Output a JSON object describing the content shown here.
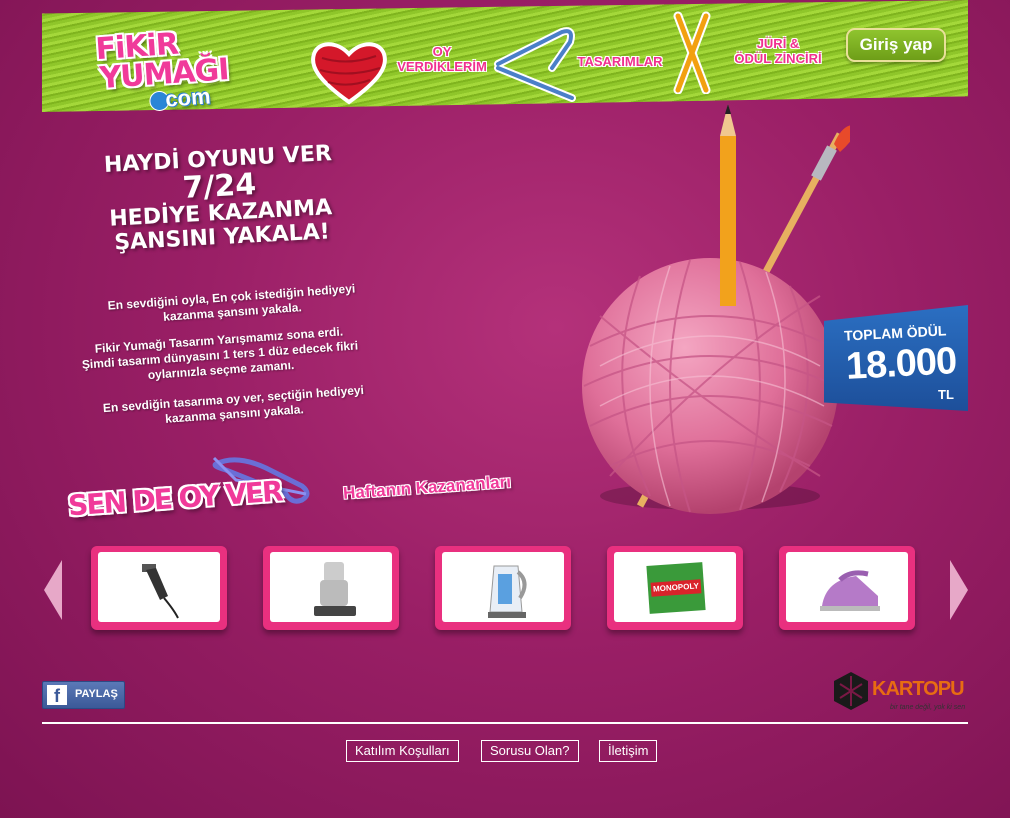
{
  "header": {
    "logo": {
      "line1": "FiKiR",
      "line2": "YUMAĞI",
      "domain": "com"
    },
    "nav": [
      {
        "line1": "OY",
        "line2": "VERDİKLERİM"
      },
      {
        "line1": "TASARIMLAR",
        "line2": ""
      },
      {
        "line1": "JÜRİ &",
        "line2": "ÖDÜL ZİNCİRİ"
      }
    ],
    "login_label": "Giriş yap"
  },
  "hero": {
    "lines": [
      "HAYDİ OYUNU VER",
      "7/24",
      "HEDİYE KAZANMA",
      "ŞANSINI YAKALA!"
    ],
    "para1": [
      "En sevdiğini oyla, En çok istediğin hediyeyi",
      "kazanma şansını yakala."
    ],
    "para2": [
      "Fikir Yumağı Tasarım Yarışmamız sona erdi.",
      "Şimdi tasarım dünyasını 1 ters 1 düz edecek fikri",
      "oylarınızla seçme zamanı."
    ],
    "para3": [
      "En sevdiğin tasarıma oy ver, seçtiğin hediyeyi",
      "kazanma şansını yakala."
    ]
  },
  "actions": {
    "vote_label": "SEN DE OY VER",
    "winners_label": "Haftanın Kazananları"
  },
  "prize": {
    "title": "TOPLAM ÖDÜL",
    "value": "18.000",
    "currency": "TL"
  },
  "carousel": {
    "items": [
      {
        "icon": "hair-clipper-icon"
      },
      {
        "icon": "tea-maker-icon"
      },
      {
        "icon": "kettle-icon"
      },
      {
        "icon": "monopoly-game-icon",
        "label": "MONOPOLY"
      },
      {
        "icon": "steam-iron-icon"
      }
    ]
  },
  "footer": {
    "share_label": "PAYLAŞ",
    "brand": {
      "name": "KARTOPU",
      "tagline": "bir tane değil, yok ki sen"
    },
    "links": [
      "Katılım Koşulları",
      "Sorusu Olan?",
      "İletişim"
    ]
  },
  "colors": {
    "background": "#9a1f66",
    "accent_pink": "#f03a9a",
    "grass": "#8fc62a",
    "prize_blue": "#2b6fc2",
    "brand_orange": "#e86c12"
  }
}
